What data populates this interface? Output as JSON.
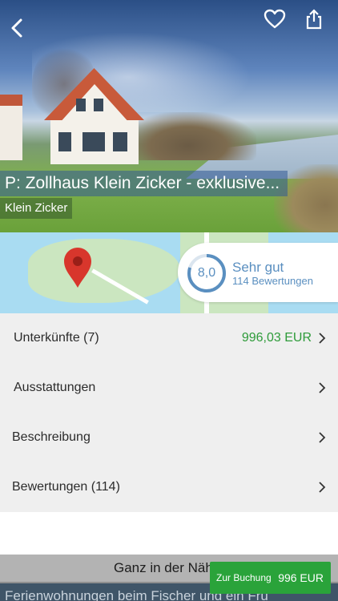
{
  "hero": {
    "title": "P: Zollhaus Klein Zicker - exklusive...",
    "location": "Klein Zicker",
    "icons": {
      "back": "chevron-left-icon",
      "favorite": "heart-outline-icon",
      "share": "share-icon"
    }
  },
  "rating": {
    "score": "8,0",
    "label": "Sehr gut",
    "count": "114 Bewertungen",
    "level": 0.8
  },
  "list": {
    "items": [
      {
        "label": "Unterkünfte (7)",
        "price": "996,03 EUR"
      },
      {
        "label": "Ausstattungen"
      },
      {
        "label": "Beschreibung"
      },
      {
        "label": "Bewertungen (114)"
      }
    ]
  },
  "bottom": {
    "nearby": "Ganz in der Näh",
    "teaser": "Ferienwohnungen beim Fischer und ein Fru",
    "book_label": "Zur Buchung",
    "book_price": "996 EUR"
  },
  "colors": {
    "accent_green": "#2aa33a",
    "price_green": "#2e9b3a",
    "rating_blue": "#5a8fc0",
    "list_bg": "#efefef"
  }
}
